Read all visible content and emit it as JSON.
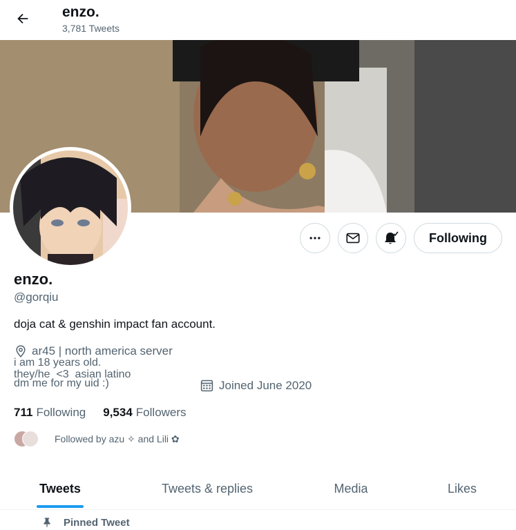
{
  "header": {
    "name": "enzo.",
    "tweet_count": "3,781 Tweets"
  },
  "profile": {
    "display_name": "enzo.",
    "handle": "@gorqiu",
    "bio": "doja cat & genshin impact fan account.",
    "location": "ar45 | north america server",
    "location_extra": [
      "i am 18 years old.",
      "they/he  <3  asian latino",
      "dm me for my uid :)"
    ],
    "joined": "Joined June 2020"
  },
  "actions": {
    "follow_label": "Following"
  },
  "stats": {
    "following_count": "711",
    "following_label": "Following",
    "followers_count": "9,534",
    "followers_label": "Followers"
  },
  "followed_by": "Followed by azu ✧ and Lili ✿",
  "tabs": [
    {
      "label": "Tweets",
      "active": true
    },
    {
      "label": "Tweets & replies"
    },
    {
      "label": "Media"
    },
    {
      "label": "Likes"
    }
  ],
  "pinned_label": "Pinned Tweet",
  "colors": {
    "accent": "#1d9bf0",
    "text": "#0f1419",
    "muted": "#536471"
  }
}
